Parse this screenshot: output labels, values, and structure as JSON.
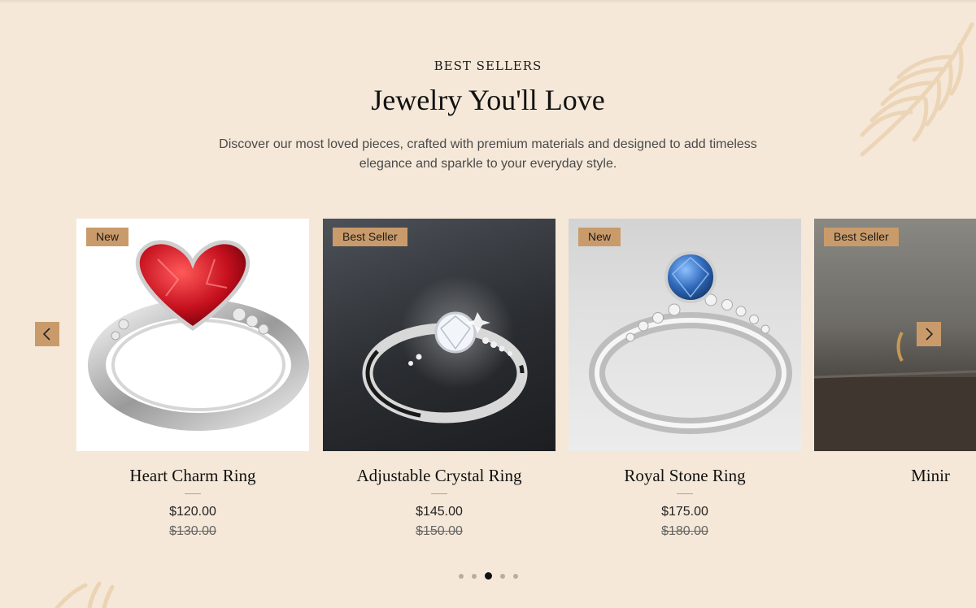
{
  "section": {
    "eyebrow": "BEST SELLERS",
    "title": "Jewelry You'll Love",
    "description": "Discover our most loved pieces, crafted with premium materials and designed to add timeless elegance and sparkle to your everyday style."
  },
  "products": [
    {
      "badge": "New",
      "name": "Heart Charm Ring",
      "price": "$120.00",
      "old_price": "$130.00",
      "stone_color": "#c5101e"
    },
    {
      "badge": "Best Seller",
      "name": "Adjustable Crystal Ring",
      "price": "$145.00",
      "old_price": "$150.00",
      "stone_color": "#f2f6fa"
    },
    {
      "badge": "New",
      "name": "Royal Stone Ring",
      "price": "$175.00",
      "old_price": "$180.00",
      "stone_color": "#2f68b8"
    },
    {
      "badge": "Best Seller",
      "name": "Minir",
      "price": "",
      "old_price": "",
      "stone_color": ""
    }
  ],
  "carousel": {
    "prev_icon": "chevron-left-icon",
    "next_icon": "chevron-right-icon",
    "dot_count": 5,
    "active_dot": 3
  },
  "colors": {
    "background": "#f5e8d8",
    "accent": "#c99b6b"
  }
}
